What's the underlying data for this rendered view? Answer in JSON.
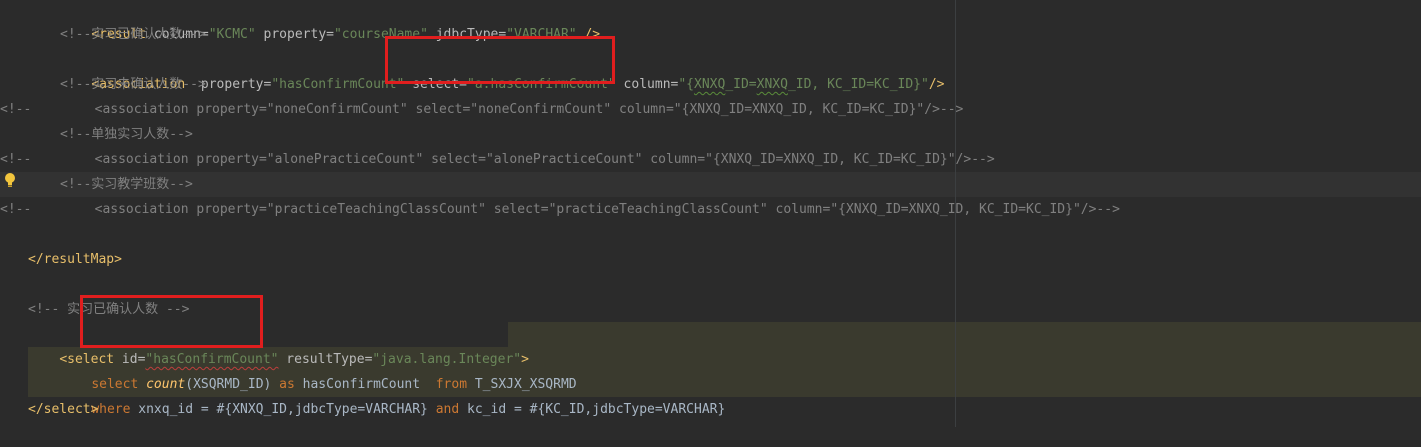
{
  "colors": {
    "background": "#2b2b2b",
    "tag": "#e8bf6a",
    "attribute_value": "#6a8759",
    "comment": "#808080",
    "keyword": "#cc7832",
    "highlight": "#e01e1e"
  },
  "icons": {
    "intention_bulb": "lightbulb-icon"
  },
  "code": {
    "l1": {
      "open": "<result",
      "a1": " column=",
      "v1": "\"KCMC\"",
      "a2": " property=",
      "v2": "\"courseName\"",
      "a3": " jdbcType=",
      "v3": "\"VARCHAR\"",
      "close": " />"
    },
    "l2": {
      "comment": "<!--实习已确认人数-->"
    },
    "l3": {
      "open": "<association",
      "a1": "  property=",
      "v1": "\"hasConfirmCount\"",
      "a2": " select=",
      "v2": "\"a.hasConfirmCount\"",
      "a3": " column=",
      "v3a": "\"{",
      "v3b": "XNXQ",
      "v3c": "_ID=",
      "v3d": "XNXQ",
      "v3e": "_ID, KC_ID=KC_ID}\"",
      "close": "/>"
    },
    "l4": {
      "comment": "<!--实习未确认人数-->"
    },
    "l5": {
      "prefix": "<!--",
      "rest": "    <association property=\"noneConfirmCount\" select=\"noneConfirmCount\" column=\"{XNXQ_ID=XNXQ_ID, KC_ID=KC_ID}\"/>-->"
    },
    "l6": {
      "comment": "<!--单独实习人数-->"
    },
    "l7": {
      "prefix": "<!--",
      "rest": "    <association property=\"alonePracticeCount\" select=\"alonePracticeCount\" column=\"{XNXQ_ID=XNXQ_ID, KC_ID=KC_ID}\"/>-->"
    },
    "l8": {
      "comment": "<!--实习教学班数-->"
    },
    "l9": {
      "prefix": "<!--",
      "rest": "    <association property=\"practiceTeachingClassCount\" select=\"practiceTeachingClassCount\" column=\"{XNXQ_ID=XNXQ_ID, KC_ID=KC_ID}\"/>-->"
    },
    "l10": {
      "tag": "</resultMap>"
    },
    "l11": {
      "comment": "<!-- 实习已确认人数 -->"
    },
    "l12": {
      "open": "<select",
      "a1": " id=",
      "v1": "\"hasConfirmCount\"",
      "a2": " resultType=",
      "v2": "\"java.lang.Integer\"",
      "close": ">"
    },
    "l13": {
      "k1": "select ",
      "fn": "count",
      "p1": "(XSQRMD_ID) ",
      "k2": "as",
      "p2": " hasConfirmCount  ",
      "k3": "from",
      "p3": " T_SXJX_XSQRMD"
    },
    "l14": {
      "k1": "where",
      "p1": " xnxq_id = #{XNXQ_ID,jdbcType=VARCHAR} ",
      "k2": "and",
      "p2": " kc_id = #{KC_ID,jdbcType=VARCHAR}"
    },
    "l15": {
      "tag": "</select>"
    }
  }
}
